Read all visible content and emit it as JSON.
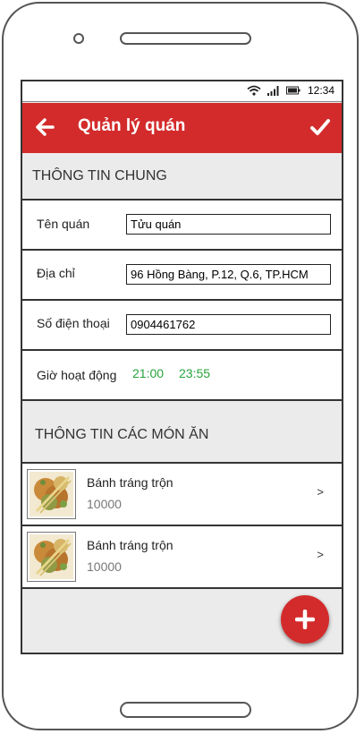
{
  "status_bar": {
    "time": "12:34",
    "icons": [
      "wifi-icon",
      "signal-icon",
      "battery-icon"
    ]
  },
  "app_bar": {
    "title": "Quản lý quán",
    "back_icon": "arrow-left-icon",
    "confirm_icon": "check-icon",
    "color": "#d32b2b"
  },
  "general": {
    "header": "THÔNG TIN CHUNG",
    "name_label": "Tên quán",
    "name_value": "Tửu quán",
    "address_label": "Địa chỉ",
    "address_value": "96 Hồng Bàng, P.12, Q.6, TP.HCM",
    "phone_label": "Số điện thoại",
    "phone_value": "0904461762",
    "hours_label": "Giờ hoạt động",
    "open_time": "21:00",
    "close_time": "23:55"
  },
  "dishes": {
    "header": "THÔNG TIN CÁC MÓN ĂN",
    "items": [
      {
        "name": "Bánh tráng trộn",
        "price": "10000",
        "chevron": ">"
      },
      {
        "name": "Bánh tráng trộn",
        "price": "10000",
        "chevron": ">"
      }
    ]
  },
  "fab": {
    "icon": "plus-icon"
  }
}
